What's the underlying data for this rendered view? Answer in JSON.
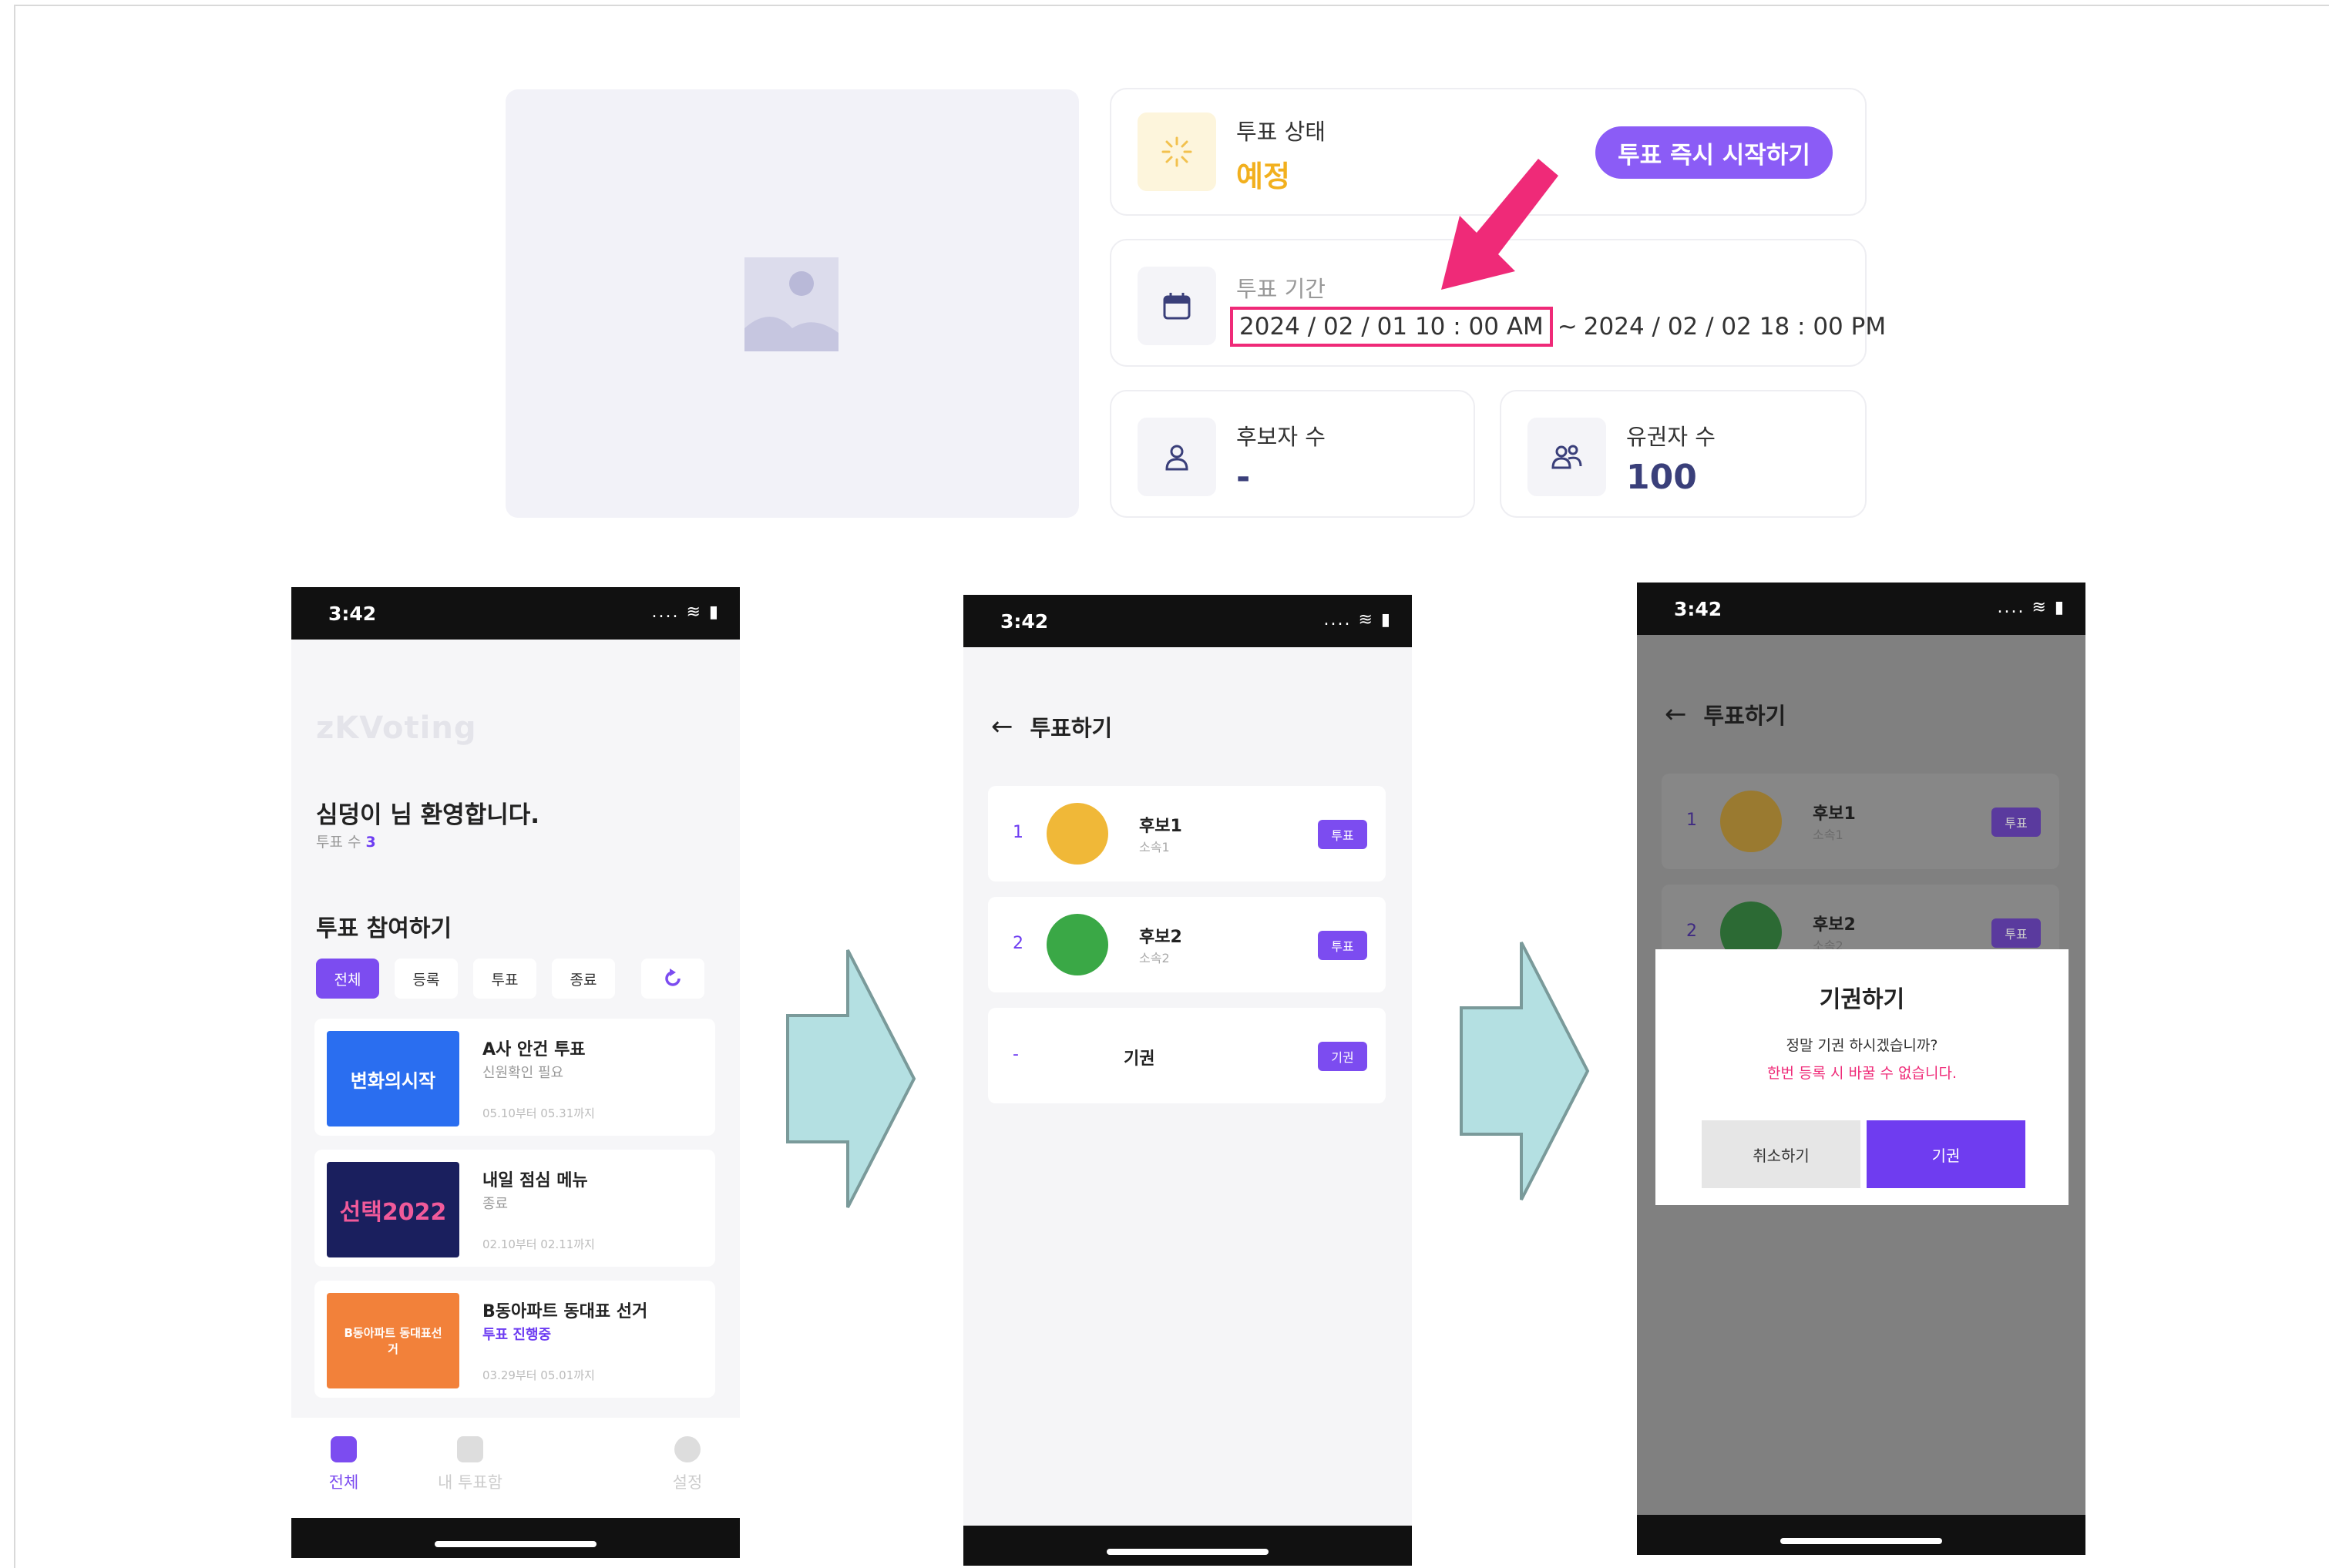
{
  "admin": {
    "status": {
      "label": "투표 상태",
      "value": "예정",
      "start_button": "투표 즉시 시작하기"
    },
    "period": {
      "label": "투표 기간",
      "start": "2024 / 02 / 01  10 : 00 AM",
      "separator": "~",
      "end": "2024 / 02 / 02  18 : 00 PM"
    },
    "candidates": {
      "label": "후보자 수",
      "value": "-"
    },
    "voters": {
      "label": "유권자 수",
      "value": "100"
    },
    "colors": {
      "accent": "#8b5cf6",
      "status_pending": "#f2b01e",
      "highlight": "#ef2a78"
    }
  },
  "screens": [
    {
      "status_time": "3:42",
      "logo": "zKVoting",
      "welcome": "심덩이 님 환영합니다.",
      "vote_count_label": "투표 수",
      "vote_count": "3",
      "section_title": "투표 참여하기",
      "filters": [
        "전체",
        "등록",
        "투표",
        "종료"
      ],
      "votes": [
        {
          "title": "A사 안건 투표",
          "status": "신원확인 필요",
          "dates": "05.10부터 05.31까지",
          "thumb_text": "변화의시작"
        },
        {
          "title": "내일 점심 메뉴",
          "status": "종료",
          "dates": "02.10부터 02.11까지",
          "thumb_text": "선택2022"
        },
        {
          "title": "B동아파트 동대표 선거",
          "status": "투표 진행중",
          "dates": "03.29부터 05.01까지",
          "thumb_text": "B동아파트 동대표선거"
        }
      ],
      "tabs": [
        "전체",
        "내 투표함",
        "설정"
      ]
    },
    {
      "status_time": "3:42",
      "header": "투표하기",
      "candidates": [
        {
          "num": "1",
          "name": "후보1",
          "affiliation": "소속1",
          "button": "투표"
        },
        {
          "num": "2",
          "name": "후보2",
          "affiliation": "소속2",
          "button": "투표"
        }
      ],
      "abstain": {
        "num": "-",
        "label": "기권",
        "button": "기권"
      }
    },
    {
      "status_time": "3:42",
      "header": "투표하기",
      "candidates": [
        {
          "num": "1",
          "name": "후보1",
          "affiliation": "소속1",
          "button": "투표"
        },
        {
          "num": "2",
          "name": "후보2",
          "affiliation": "소속2",
          "button": "투표"
        }
      ],
      "dialog": {
        "title": "기권하기",
        "message": "정말 기권 하시겠습니까?",
        "warning": "한번 등록 시 바꿀 수 없습니다.",
        "cancel": "취소하기",
        "confirm": "기권"
      }
    }
  ]
}
